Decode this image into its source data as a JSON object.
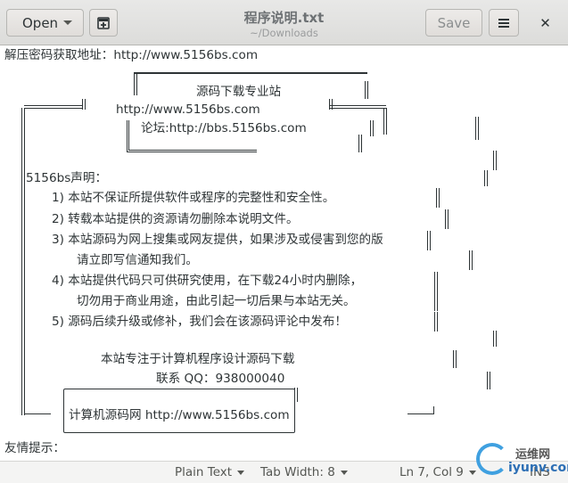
{
  "header": {
    "open_label": "Open",
    "title": "程序说明.txt",
    "subtitle": "~/Downloads",
    "save_label": "Save"
  },
  "document": {
    "lines": [
      "解压密码获取地址：http://www.5156bs.com",
      "源码下载专业站",
      "http://www.5156bs.com",
      "论坛:http://bbs.5156bs.com",
      "5156bs声明：",
      "1) 本站不保证所提供软件或程序的完整性和安全性。",
      "2) 转载本站提供的资源请勿删除本说明文件。",
      "3) 本站源码为网上搜集或网友提供，如果涉及或侵害到您的版",
      "请立即写信通知我们。",
      "4) 本站提供代码只可供研究使用，在下载24小时内删除，",
      "切勿用于商业用途，由此引起一切后果与本站无关。",
      "5) 源码后续升级或修补，我们会在该源码评论中发布！",
      "本站专注于计算机程序设计源码下载",
      "联系 QQ：938000040",
      "计算机源码网 http://www.5156bs.com",
      "友情提示："
    ]
  },
  "statusbar": {
    "syntax": "Plain Text",
    "tab_width": "Tab Width: 8",
    "position": "Ln 7, Col 9",
    "mode": "INS"
  },
  "watermark": {
    "line1": "运维网",
    "line2": "iyunv.com"
  },
  "colors": {
    "header_bg": "#dcdcda",
    "text": "#2e3436",
    "save_disabled": "#8b8e8f"
  }
}
